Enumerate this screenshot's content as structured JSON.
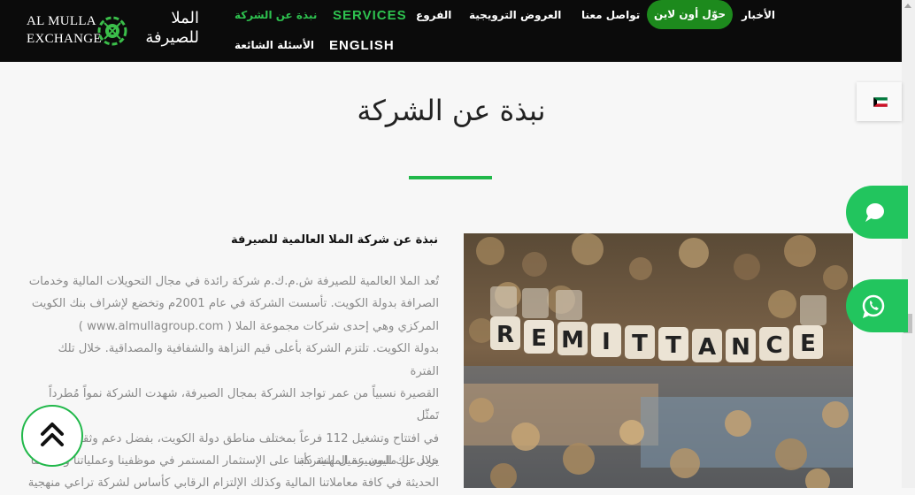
{
  "header": {
    "logo": {
      "text_en_line1": "AL MULLA",
      "text_en_line2": "EXCHANGE",
      "text_ar_line1": "الملا",
      "text_ar_line2": "للصيرفة"
    },
    "nav": [
      {
        "label": "الأخبار"
      },
      {
        "label": "حوّل أون لاين",
        "highlight": true
      },
      {
        "label": "تواصل معنا"
      },
      {
        "label": "العروض الترويجية"
      },
      {
        "label": "الفروع"
      },
      {
        "label": "SERVICES"
      },
      {
        "label": "نبذة عن الشركة",
        "active": true
      },
      {
        "label": "ENGLISH"
      },
      {
        "label": "الأسئلة الشائعة"
      }
    ]
  },
  "page": {
    "title": "نبذة عن الشركة",
    "section_heading": "نبذة عن شركة الملا العالمية للصيرفة",
    "paragraph1": [
      "تُعد الملا العالمية للصيرفة ش.م.ك.م شركة رائدة في مجال التحويلات المالية وخدمات",
      "الصرافة بدولة الكويت. تأسست الشركة في عام 2001م وتخضع لإشراف بنك الكويت",
      "المركزي وهي إحدى شركات مجموعة الملا ( www.almullagroup.com )",
      "بدولة الكويت. تلتزم الشركة بأعلى قيم النزاهة والشفافية والمصداقية. خلال تلك الفترة",
      "القصيرة نسبياً من عمر تواجد الشركة بمجال الصيرفة، شهدت الشركة نمواً مُطرداً تَمثّل",
      "في افتتاح وتشغيل 112 فرعاً بمختلف مناطق دولة الكويت، بفضل دعم وثقة يمنحها ما",
      "يزيد عن مليون عميل للشركة."
    ],
    "paragraph2": [
      "خلال تلك المسيرة المهنية دأبنا على الإستثمار المستمر في موظفينا وعملياتنا وأنظمتنا",
      "الحديثة في كافة معاملاتنا المالية وكذلك الإلتزام الرقابي كأساس لشركة تراعي منهجية"
    ],
    "image_caption_word": "REMITTANCE"
  },
  "language_flag": {
    "country": "Kuwait",
    "colors": [
      "#007a3d",
      "#ffffff",
      "#ce1126",
      "#000000"
    ]
  },
  "floating_buttons": {
    "chat": "chat-icon",
    "whatsapp": "whatsapp-icon",
    "back_to_top": "double-chevron-up-icon"
  },
  "colors": {
    "brand_green": "#21b84a",
    "topbar": "#0b0b0b",
    "button_green": "#1d8a1d"
  }
}
